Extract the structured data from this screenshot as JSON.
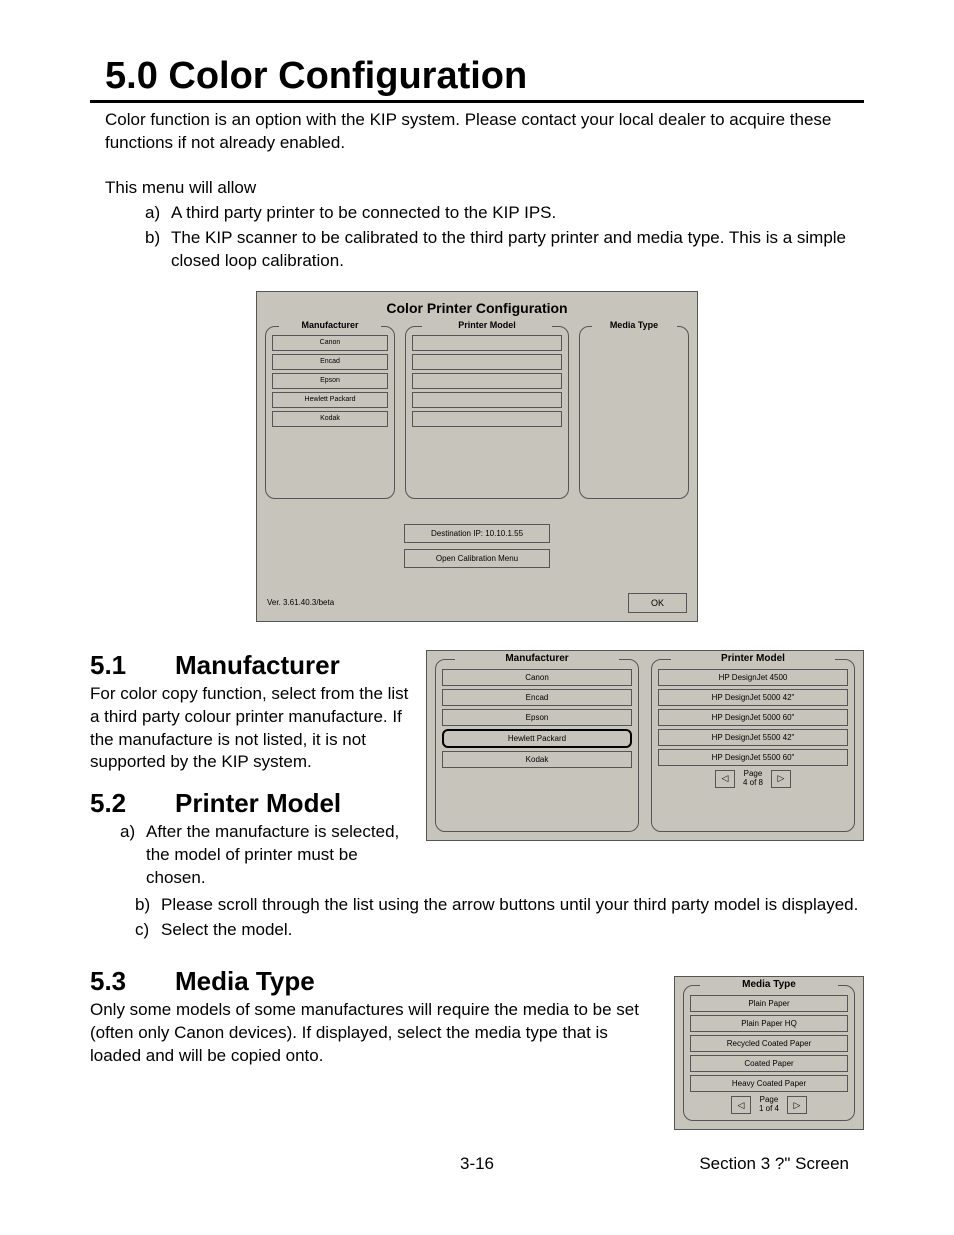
{
  "h1": "5.0  Color Configuration",
  "intro": "Color function is an option with the KIP system. Please contact your local dealer to acquire these functions if not already enabled.",
  "menu_intro": "This menu will allow",
  "menu_items": {
    "a_mk": "a)",
    "a": "A third party printer to be connected to the KIP IPS.",
    "b_mk": "b)",
    "b": "The KIP scanner to be calibrated to the third party printer and media type. This is a simple closed loop calibration."
  },
  "fig1": {
    "title": "Color Printer Configuration",
    "col1": "Manufacturer",
    "col2": "Printer Model",
    "col3": "Media Type",
    "m": [
      "Canon",
      "Encad",
      "Epson",
      "Hewlett Packard",
      "Kodak"
    ],
    "dest": "Destination IP: 10.10.1.55",
    "cal": "Open Calibration Menu",
    "ver": "Ver. 3.61.40.3/beta",
    "ok": "OK"
  },
  "s51": {
    "num": "5.1",
    "title": "Manufacturer",
    "body": "For color copy function, select from the list a third party colour printer manufacture. If the manufacture is not listed, it is not supported by the KIP system."
  },
  "s52": {
    "num": "5.2",
    "title": "Printer Model",
    "a_mk": "a)",
    "a": "After the manufacture is selected, the model of printer must be chosen.",
    "b_mk": "b)",
    "b": "Please scroll through the list using the arrow buttons until your third party model is displayed.",
    "c_mk": "c)",
    "c": "Select the model."
  },
  "fig2": {
    "col1": "Manufacturer",
    "col2": "Printer Model",
    "m": [
      "Canon",
      "Encad",
      "Epson",
      "Hewlett Packard",
      "Kodak"
    ],
    "p": [
      "HP DesignJet 4500",
      "HP DesignJet 5000 42\"",
      "HP DesignJet 5000 60\"",
      "HP DesignJet 5500 42\"",
      "HP DesignJet 5500 60\""
    ],
    "pg1": "Page",
    "pg2": "4 of 8"
  },
  "s53": {
    "num": "5.3",
    "title": "Media Type",
    "body": "Only some models of some manufactures will require the media to be set (often only Canon devices). If displayed, select the media type that is loaded and will be copied onto."
  },
  "fig3": {
    "title": "Media Type",
    "items": [
      "Plain Paper",
      "Plain Paper HQ",
      "Recycled Coated Paper",
      "Coated Paper",
      "Heavy Coated Paper"
    ],
    "pg1": "Page",
    "pg2": "1 of 4"
  },
  "footer": {
    "c": "3-16",
    "r": "Section 3     ?\" Screen"
  }
}
